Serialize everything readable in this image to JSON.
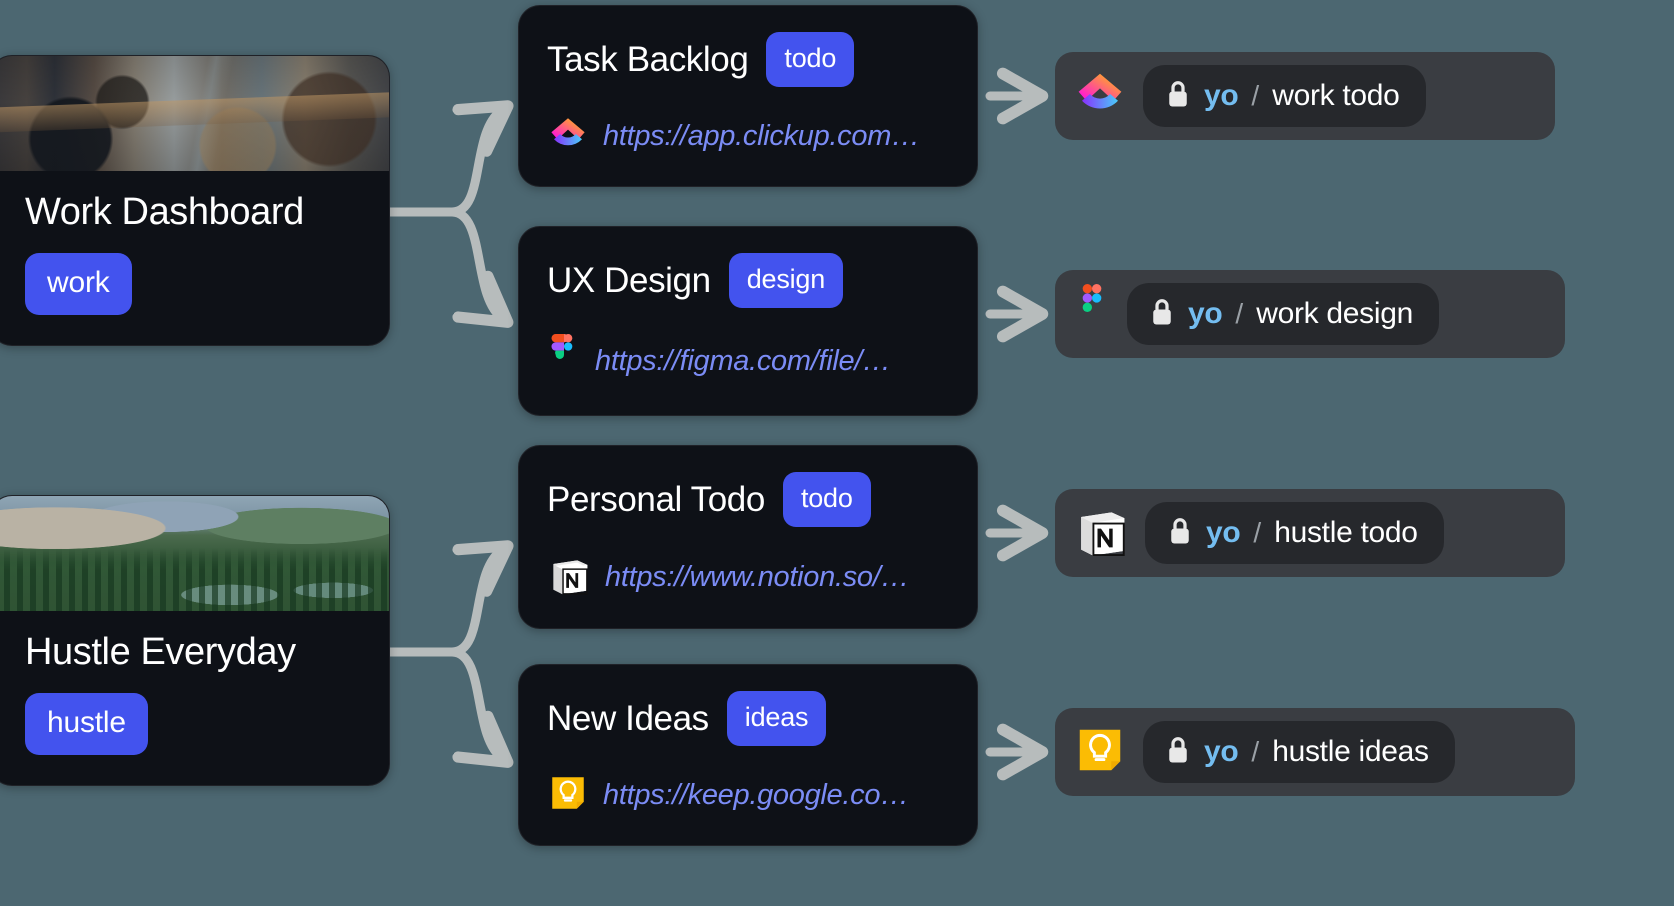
{
  "theme": {
    "background": "#4c6771",
    "card_bg": "#0e1117",
    "badge_blue": "#4353ee",
    "url_blue": "#7b8cf5",
    "panel_bg": "#3a3d42",
    "pill_bg": "#26282c",
    "owner_blue": "#74bdf0",
    "arrow_gray": "#b7bcbc"
  },
  "sources": [
    {
      "title": "Work Dashboard",
      "badge": "work",
      "thumbnail": "office-workspace-photo"
    },
    {
      "title": "Hustle Everyday",
      "badge": "hustle",
      "thumbnail": "mountain-landscape-photo"
    }
  ],
  "links": [
    {
      "title": "Task Backlog",
      "badge": "todo",
      "url": "https://app.clickup.com…",
      "icon": "clickup-icon"
    },
    {
      "title": "UX Design",
      "badge": "design",
      "url": "https://figma.com/file/…",
      "icon": "figma-icon"
    },
    {
      "title": "Personal Todo",
      "badge": "todo",
      "url": "https://www.notion.so/…",
      "icon": "notion-icon"
    },
    {
      "title": "New Ideas",
      "badge": "ideas",
      "url": "https://keep.google.co…",
      "icon": "google-keep-icon"
    }
  ],
  "repos": [
    {
      "icon": "clickup-icon",
      "lock": "lock-icon",
      "owner": "yo",
      "separator": "/",
      "name": "work todo"
    },
    {
      "icon": "figma-icon",
      "lock": "lock-icon",
      "owner": "yo",
      "separator": "/",
      "name": "work design"
    },
    {
      "icon": "notion-icon",
      "lock": "lock-icon",
      "owner": "yo",
      "separator": "/",
      "name": "hustle todo"
    },
    {
      "icon": "google-keep-icon",
      "lock": "lock-icon",
      "owner": "yo",
      "separator": "/",
      "name": "hustle ideas"
    }
  ]
}
